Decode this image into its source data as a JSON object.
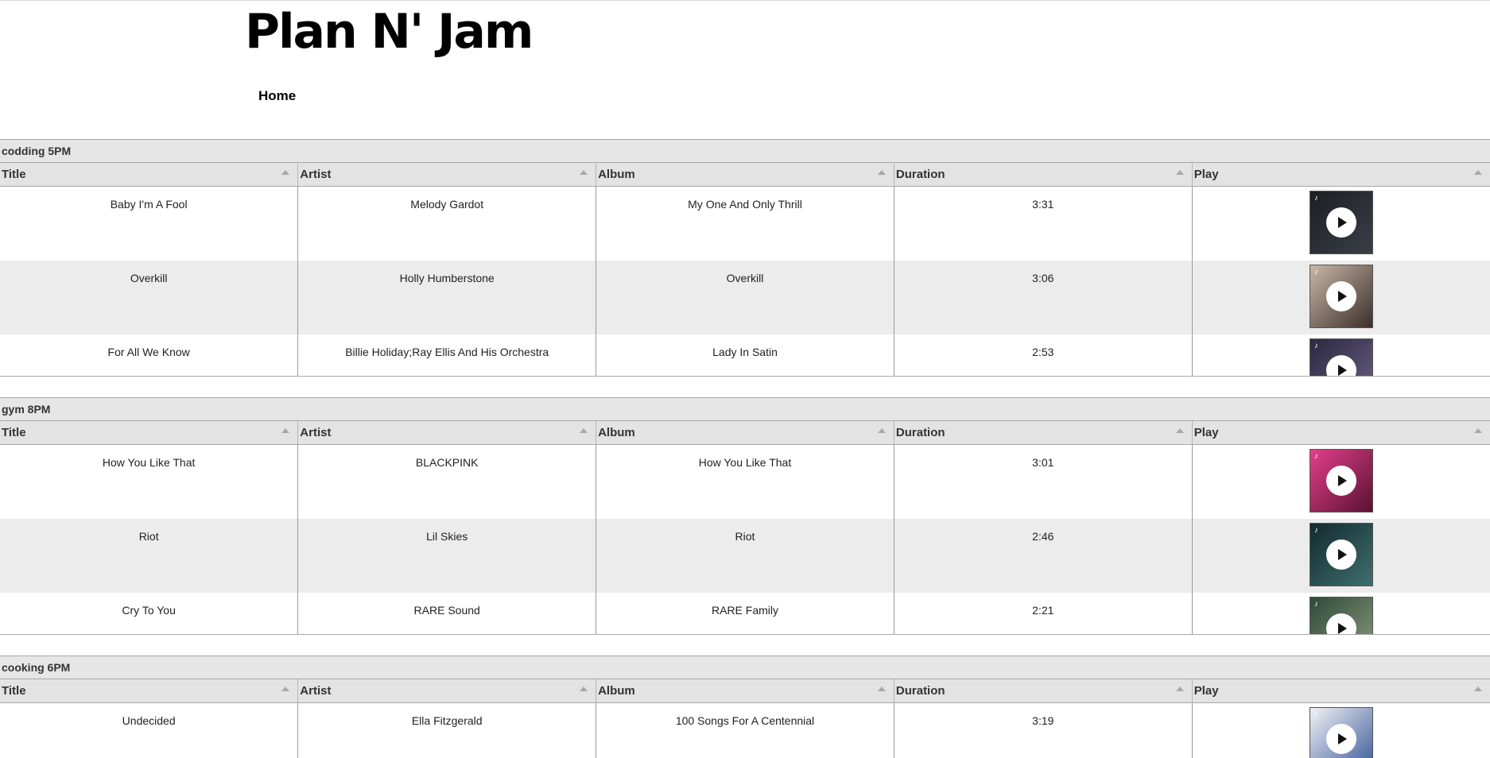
{
  "site": {
    "title": "Plan N' Jam",
    "nav_home": "Home"
  },
  "columns": [
    "Title",
    "Artist",
    "Album",
    "Duration",
    "Play"
  ],
  "icons": {
    "sort": "sort-ascending-icon",
    "play": "play-icon",
    "note": "music-note-icon"
  },
  "playlists": [
    {
      "name": "codding 5PM",
      "tracks": [
        {
          "title": "Baby I'm A Fool",
          "artist": "Melody Gardot",
          "album": "My One And Only Thrill",
          "duration": "3:31",
          "art_colors": [
            "#1c1f24",
            "#3a3f47"
          ]
        },
        {
          "title": "Overkill",
          "artist": "Holly Humberstone",
          "album": "Overkill",
          "duration": "3:06",
          "art_colors": [
            "#c9b6a6",
            "#3b2f2a"
          ]
        },
        {
          "title": "For All We Know",
          "artist": "Billie Holiday;Ray Ellis And His Orchestra",
          "album": "Lady In Satin",
          "duration": "2:53",
          "art_colors": [
            "#2b2840",
            "#6a5f82"
          ]
        }
      ]
    },
    {
      "name": "gym 8PM",
      "tracks": [
        {
          "title": "How You Like That",
          "artist": "BLACKPINK",
          "album": "How You Like That",
          "duration": "3:01",
          "art_colors": [
            "#e23f8a",
            "#5a1230"
          ]
        },
        {
          "title": "Riot",
          "artist": "Lil Skies",
          "album": "Riot",
          "duration": "2:46",
          "art_colors": [
            "#132a2e",
            "#3f6f6f"
          ]
        },
        {
          "title": "Cry To You",
          "artist": "RARE Sound",
          "album": "RARE Family",
          "duration": "2:21",
          "art_colors": [
            "#2e4a3a",
            "#8a9a7a"
          ]
        }
      ]
    },
    {
      "name": "cooking 6PM",
      "tracks": [
        {
          "title": "Undecided",
          "artist": "Ella Fitzgerald",
          "album": "100 Songs For A Centennial",
          "duration": "3:19",
          "art_colors": [
            "#f2f2f5",
            "#3a5a9a"
          ]
        }
      ]
    }
  ]
}
